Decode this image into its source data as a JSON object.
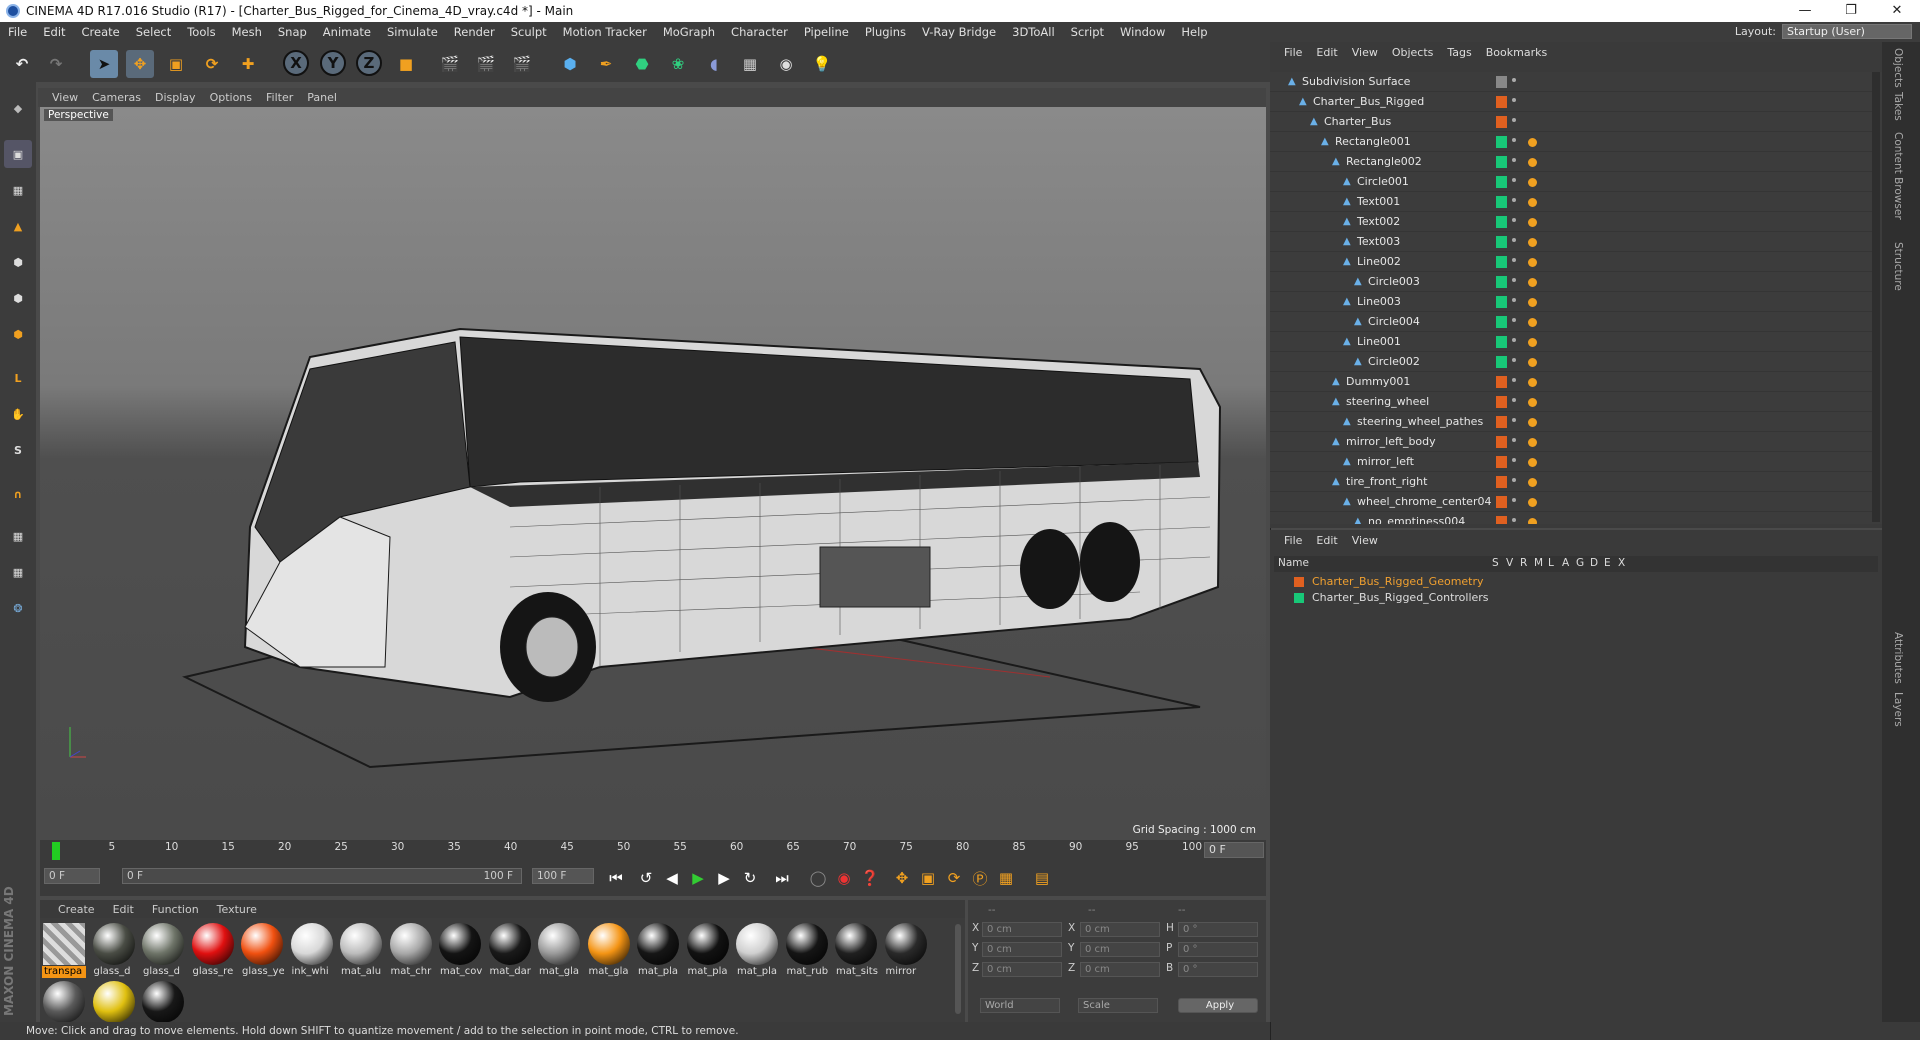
{
  "window": {
    "title": "CINEMA 4D R17.016 Studio (R17) - [Charter_Bus_Rigged_for_Cinema_4D_vray.c4d *] - Main"
  },
  "menubar": [
    "File",
    "Edit",
    "Create",
    "Select",
    "Tools",
    "Mesh",
    "Snap",
    "Animate",
    "Simulate",
    "Render",
    "Sculpt",
    "Motion Tracker",
    "MoGraph",
    "Character",
    "Pipeline",
    "Plugins",
    "V-Ray Bridge",
    "3DToAll",
    "Script",
    "Window",
    "Help"
  ],
  "layout": {
    "label": "Layout:",
    "value": "Startup (User)"
  },
  "viewport": {
    "menu": [
      "View",
      "Cameras",
      "Display",
      "Options",
      "Filter",
      "Panel"
    ],
    "camera_label": "Perspective",
    "grid_spacing": "Grid Spacing : 1000 cm"
  },
  "timeline": {
    "ticks": [
      "0",
      "5",
      "10",
      "15",
      "20",
      "25",
      "30",
      "35",
      "40",
      "45",
      "50",
      "55",
      "60",
      "65",
      "70",
      "75",
      "80",
      "85",
      "90",
      "95",
      "100"
    ],
    "current_frame": "0 F",
    "start_field": "0 F",
    "range_start": "0 F",
    "range_end": "100 F",
    "end_field": "100 F"
  },
  "material_menu": [
    "Create",
    "Edit",
    "Function",
    "Texture"
  ],
  "materials": [
    {
      "name": "transpa",
      "color": "#c8c8c8"
    },
    {
      "name": "glass_d",
      "color": "#4a4d45"
    },
    {
      "name": "glass_d",
      "color": "#6e7468"
    },
    {
      "name": "glass_re",
      "color": "#e01010"
    },
    {
      "name": "glass_ye",
      "color": "#f05010"
    },
    {
      "name": "ink_whi",
      "color": "#d8d8d8"
    },
    {
      "name": "mat_alu",
      "color": "#bcbcbc"
    },
    {
      "name": "mat_chr",
      "color": "#a8a8a8"
    },
    {
      "name": "mat_cov",
      "color": "#141414"
    },
    {
      "name": "mat_dar",
      "color": "#1a1a1a"
    },
    {
      "name": "mat_gla",
      "color": "#9a9a9a"
    },
    {
      "name": "mat_gla",
      "color": "#f49414"
    },
    {
      "name": "mat_pla",
      "color": "#161616"
    },
    {
      "name": "mat_pla",
      "color": "#121212"
    },
    {
      "name": "mat_pla",
      "color": "#cfcfcf"
    },
    {
      "name": "mat_rub",
      "color": "#151515"
    },
    {
      "name": "mat_sits",
      "color": "#202020"
    },
    {
      "name": "mirror",
      "color": "#2a2a2a"
    },
    {
      "name": "",
      "color": "#5a5a5a"
    },
    {
      "name": "",
      "color": "#e0c010"
    },
    {
      "name": "",
      "color": "#181818"
    }
  ],
  "coords": {
    "header": [
      "--",
      "--",
      "--"
    ],
    "rows": [
      {
        "a": "X",
        "av": "0 cm",
        "b": "X",
        "bv": "0 cm",
        "c": "H",
        "cv": "0 °"
      },
      {
        "a": "Y",
        "av": "0 cm",
        "b": "Y",
        "bv": "0 cm",
        "c": "P",
        "cv": "0 °"
      },
      {
        "a": "Z",
        "av": "0 cm",
        "b": "Z",
        "bv": "0 cm",
        "c": "B",
        "cv": "0 °"
      }
    ],
    "mode1": "World",
    "mode2": "Scale",
    "apply": "Apply"
  },
  "objects_menu": [
    "File",
    "Edit",
    "View",
    "Objects",
    "Tags",
    "Bookmarks"
  ],
  "objects": [
    {
      "name": "Subdivision Surface",
      "indent": 0,
      "color": "#888"
    },
    {
      "name": "Charter_Bus_Rigged",
      "indent": 1,
      "color": "#e06020"
    },
    {
      "name": "Charter_Bus",
      "indent": 2,
      "color": "#e06020"
    },
    {
      "name": "Rectangle001",
      "indent": 3,
      "color": "#18c878"
    },
    {
      "name": "Rectangle002",
      "indent": 4,
      "color": "#18c878"
    },
    {
      "name": "Circle001",
      "indent": 5,
      "color": "#18c878"
    },
    {
      "name": "Text001",
      "indent": 5,
      "color": "#18c878"
    },
    {
      "name": "Text002",
      "indent": 5,
      "color": "#18c878"
    },
    {
      "name": "Text003",
      "indent": 5,
      "color": "#18c878"
    },
    {
      "name": "Line002",
      "indent": 5,
      "color": "#18c878"
    },
    {
      "name": "Circle003",
      "indent": 6,
      "color": "#18c878"
    },
    {
      "name": "Line003",
      "indent": 5,
      "color": "#18c878"
    },
    {
      "name": "Circle004",
      "indent": 6,
      "color": "#18c878"
    },
    {
      "name": "Line001",
      "indent": 5,
      "color": "#18c878"
    },
    {
      "name": "Circle002",
      "indent": 6,
      "color": "#18c878"
    },
    {
      "name": "Dummy001",
      "indent": 4,
      "color": "#e06020"
    },
    {
      "name": "steering_wheel",
      "indent": 4,
      "color": "#e06020"
    },
    {
      "name": "steering_wheel_pathes",
      "indent": 5,
      "color": "#e06020"
    },
    {
      "name": "mirror_left_body",
      "indent": 4,
      "color": "#e06020"
    },
    {
      "name": "mirror_left",
      "indent": 5,
      "color": "#e06020"
    },
    {
      "name": "tire_front_right",
      "indent": 4,
      "color": "#e06020"
    },
    {
      "name": "wheel_chrome_center04",
      "indent": 5,
      "color": "#e06020"
    },
    {
      "name": "no_emptiness004",
      "indent": 6,
      "color": "#e06020"
    }
  ],
  "layers_menu": [
    "File",
    "Edit",
    "View"
  ],
  "layers_header": [
    "Name",
    "S",
    "V",
    "R",
    "M",
    "L",
    "A",
    "G",
    "D",
    "E",
    "X"
  ],
  "layers": [
    {
      "name": "Charter_Bus_Rigged_Geometry",
      "color": "#e06020",
      "text_color": "#f0a030"
    },
    {
      "name": "Charter_Bus_Rigged_Controllers",
      "color": "#18c878",
      "text_color": "#dddddd"
    }
  ],
  "right_tabs": [
    "Objects",
    "Takes",
    "Content Browser",
    "Structure",
    "Attributes",
    "Layers"
  ],
  "status": "Move: Click and drag to move elements. Hold down SHIFT to quantize movement / add to the selection in point mode, CTRL to remove."
}
